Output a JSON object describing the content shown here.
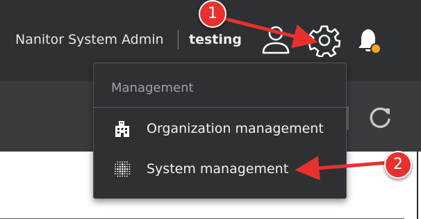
{
  "header": {
    "user_name": "Nanitor System Admin",
    "organization": "testing",
    "icons": [
      "user-icon",
      "gear-icon",
      "bell-icon"
    ],
    "notification_dot_color": "#f5a623"
  },
  "toolbar": {
    "icons": [
      "refresh-icon"
    ]
  },
  "dropdown": {
    "header": "Management",
    "items": [
      {
        "label": "Organization management",
        "icon": "building-icon"
      },
      {
        "label": "System management",
        "icon": "dots-grid-icon"
      }
    ]
  },
  "annotations": {
    "callout_1": "1",
    "callout_2": "2",
    "color": "#e8312e"
  }
}
